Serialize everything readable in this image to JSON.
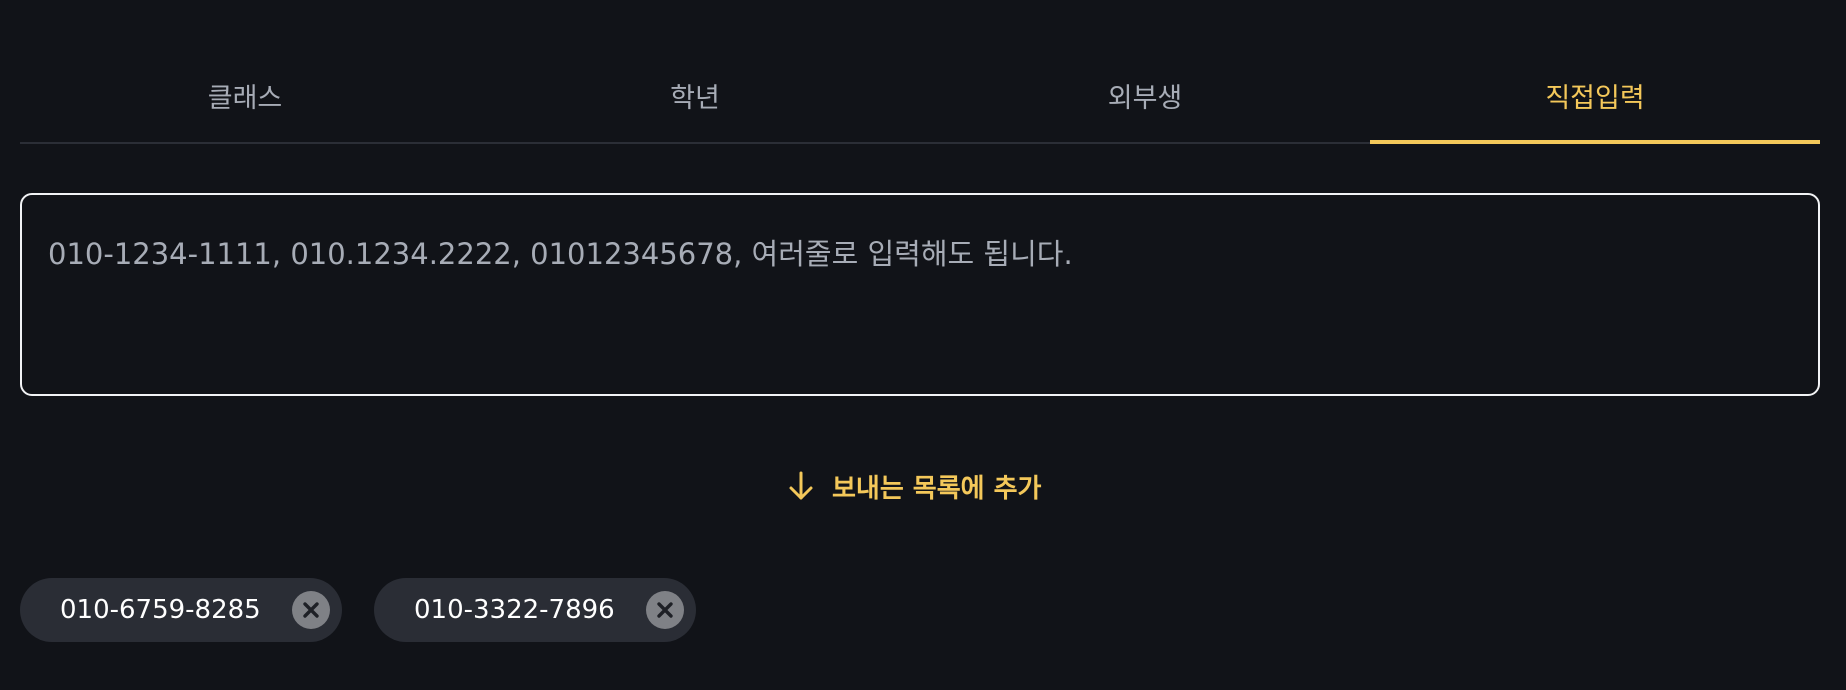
{
  "tabs": [
    {
      "label": "클래스",
      "active": false
    },
    {
      "label": "학년",
      "active": false
    },
    {
      "label": "외부생",
      "active": false
    },
    {
      "label": "직접입력",
      "active": true
    }
  ],
  "input": {
    "value": "",
    "placeholder": "010-1234-1111, 010.1234.2222, 01012345678, 여러줄로 입력해도 됩니다."
  },
  "add_button": {
    "label": "보내는 목록에 추가",
    "icon": "arrow-down-icon"
  },
  "recipients": [
    {
      "number": "010-6759-8285",
      "icon": "close-circle-icon"
    },
    {
      "number": "010-3322-7896",
      "icon": "close-circle-icon"
    }
  ],
  "colors": {
    "background": "#111318",
    "accent": "#f4c85a",
    "tab_inactive": "#a7acb6",
    "chip_background": "#2a2d35"
  }
}
